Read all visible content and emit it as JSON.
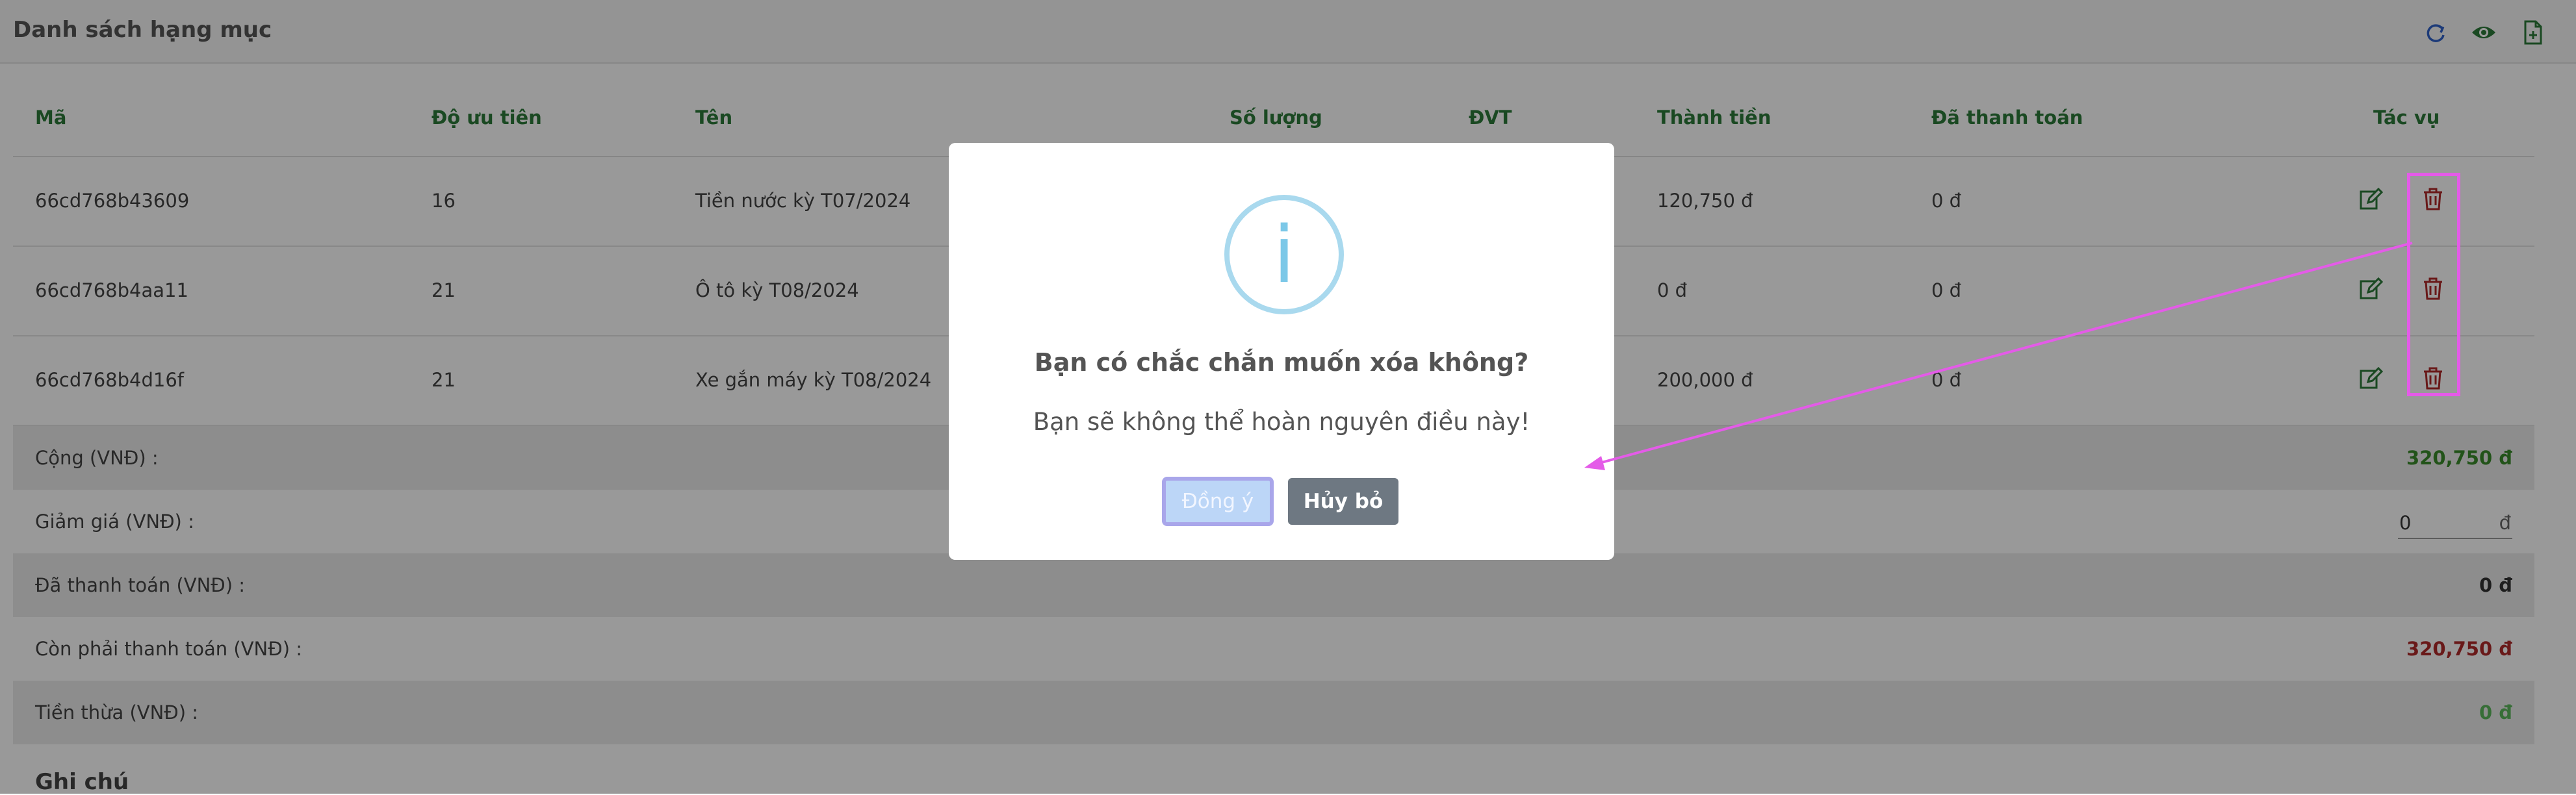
{
  "card": {
    "title": "Danh sách hạng mục"
  },
  "header_icons": [
    "refresh-icon",
    "eye-icon",
    "file-export-icon"
  ],
  "table": {
    "columns": [
      "Mã",
      "Độ ưu tiên",
      "Tên",
      "Số lượng",
      "ĐVT",
      "Thành tiền",
      "Đã thanh toán",
      "Tác vụ"
    ],
    "rows": [
      {
        "code": "66cd768b43609",
        "priority": "16",
        "name": "Tiền nước kỳ T07/2024",
        "amount": "120,750 đ",
        "paid": "0 đ"
      },
      {
        "code": "66cd768b4aa11",
        "priority": "21",
        "name": "Ô tô kỳ T08/2024",
        "amount": "0 đ",
        "paid": "0 đ"
      },
      {
        "code": "66cd768b4d16f",
        "priority": "21",
        "name": "Xe gắn máy kỳ T08/2024",
        "amount": "200,000 đ",
        "paid": "0 đ"
      }
    ]
  },
  "summary": {
    "total_label": "Cộng (VNĐ) :",
    "total_value": "320,750 đ",
    "discount_label": "Giảm giá (VNĐ) :",
    "discount_value": "0",
    "discount_unit": "đ",
    "paid_label": "Đã thanh toán (VNĐ) :",
    "paid_value": "0 đ",
    "remaining_label": "Còn phải thanh toán (VNĐ) :",
    "remaining_value": "320,750 đ",
    "change_label": "Tiền thừa (VNĐ) :",
    "change_value": "0 đ"
  },
  "notes": {
    "title": "Ghi chú"
  },
  "dialog": {
    "icon_glyph": "i",
    "title": "Bạn có chắc chắn muốn xóa không?",
    "text": "Bạn sẽ không thể hoàn nguyên điều này!",
    "confirm_label": "Đồng ý",
    "cancel_label": "Hủy bỏ"
  },
  "colors": {
    "header_green": "#2c7a3a",
    "total_green": "#3a8a2a",
    "remaining_red": "#b02a2a",
    "change_green": "#5cb85c",
    "highlight_magenta": "#e45be8"
  }
}
